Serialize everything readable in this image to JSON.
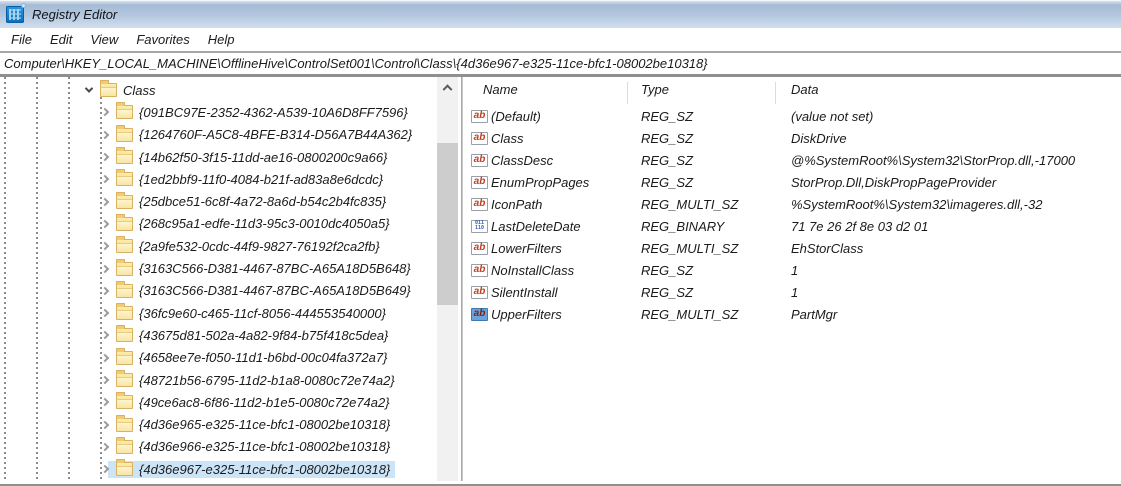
{
  "window": {
    "title": "Registry Editor"
  },
  "menu": {
    "items": [
      "File",
      "Edit",
      "View",
      "Favorites",
      "Help"
    ]
  },
  "address": {
    "path": "Computer\\HKEY_LOCAL_MACHINE\\OfflineHive\\ControlSet001\\Control\\Class\\{4d36e967-e325-11ce-bfc1-08002be10318}"
  },
  "tree": {
    "root": {
      "label": "Class",
      "expanded": true
    },
    "children": [
      {
        "label": "{091BC97E-2352-4362-A539-10A6D8FF7596}",
        "selected": false
      },
      {
        "label": "{1264760F-A5C8-4BFE-B314-D56A7B44A362}",
        "selected": false
      },
      {
        "label": "{14b62f50-3f15-11dd-ae16-0800200c9a66}",
        "selected": false
      },
      {
        "label": "{1ed2bbf9-11f0-4084-b21f-ad83a8e6dcdc}",
        "selected": false
      },
      {
        "label": "{25dbce51-6c8f-4a72-8a6d-b54c2b4fc835}",
        "selected": false
      },
      {
        "label": "{268c95a1-edfe-11d3-95c3-0010dc4050a5}",
        "selected": false
      },
      {
        "label": "{2a9fe532-0cdc-44f9-9827-76192f2ca2fb}",
        "selected": false
      },
      {
        "label": "{3163C566-D381-4467-87BC-A65A18D5B648}",
        "selected": false
      },
      {
        "label": "{3163C566-D381-4467-87BC-A65A18D5B649}",
        "selected": false
      },
      {
        "label": "{36fc9e60-c465-11cf-8056-444553540000}",
        "selected": false
      },
      {
        "label": "{43675d81-502a-4a82-9f84-b75f418c5dea}",
        "selected": false
      },
      {
        "label": "{4658ee7e-f050-11d1-b6bd-00c04fa372a7}",
        "selected": false
      },
      {
        "label": "{48721b56-6795-11d2-b1a8-0080c72e74a2}",
        "selected": false
      },
      {
        "label": "{49ce6ac8-6f86-11d2-b1e5-0080c72e74a2}",
        "selected": false
      },
      {
        "label": "{4d36e965-e325-11ce-bfc1-08002be10318}",
        "selected": false
      },
      {
        "label": "{4d36e966-e325-11ce-bfc1-08002be10318}",
        "selected": false
      },
      {
        "label": "{4d36e967-e325-11ce-bfc1-08002be10318}",
        "selected": true
      }
    ]
  },
  "values": {
    "columns": [
      "Name",
      "Type",
      "Data"
    ],
    "rows": [
      {
        "icon": "string",
        "icon_selected": false,
        "name": "(Default)",
        "type": "REG_SZ",
        "data": "(value not set)"
      },
      {
        "icon": "string",
        "icon_selected": false,
        "name": "Class",
        "type": "REG_SZ",
        "data": "DiskDrive"
      },
      {
        "icon": "string",
        "icon_selected": false,
        "name": "ClassDesc",
        "type": "REG_SZ",
        "data": "@%SystemRoot%\\System32\\StorProp.dll,-17000"
      },
      {
        "icon": "string",
        "icon_selected": false,
        "name": "EnumPropPages",
        "type": "REG_SZ",
        "data": "StorProp.Dll,DiskPropPageProvider"
      },
      {
        "icon": "string",
        "icon_selected": false,
        "name": "IconPath",
        "type": "REG_MULTI_SZ",
        "data": "%SystemRoot%\\System32\\imageres.dll,-32"
      },
      {
        "icon": "binary",
        "icon_selected": false,
        "name": "LastDeleteDate",
        "type": "REG_BINARY",
        "data": "71 7e 26 2f 8e 03 d2 01"
      },
      {
        "icon": "string",
        "icon_selected": false,
        "name": "LowerFilters",
        "type": "REG_MULTI_SZ",
        "data": "EhStorClass"
      },
      {
        "icon": "string",
        "icon_selected": false,
        "name": "NoInstallClass",
        "type": "REG_SZ",
        "data": "1"
      },
      {
        "icon": "string",
        "icon_selected": false,
        "name": "SilentInstall",
        "type": "REG_SZ",
        "data": "1"
      },
      {
        "icon": "string",
        "icon_selected": true,
        "name": "UpperFilters",
        "type": "REG_MULTI_SZ",
        "data": "PartMgr"
      }
    ]
  },
  "colors": {
    "selection_highlight": "#cce4f8",
    "folder_fill": "#f5dd9a",
    "titlebar_top": "#a5bbd5",
    "titlebar_bottom": "#d2dfee",
    "string_icon_text": "#c23b22",
    "binary_icon_text": "#2b5cc4",
    "selected_icon_bg": "#6ba3dc"
  }
}
